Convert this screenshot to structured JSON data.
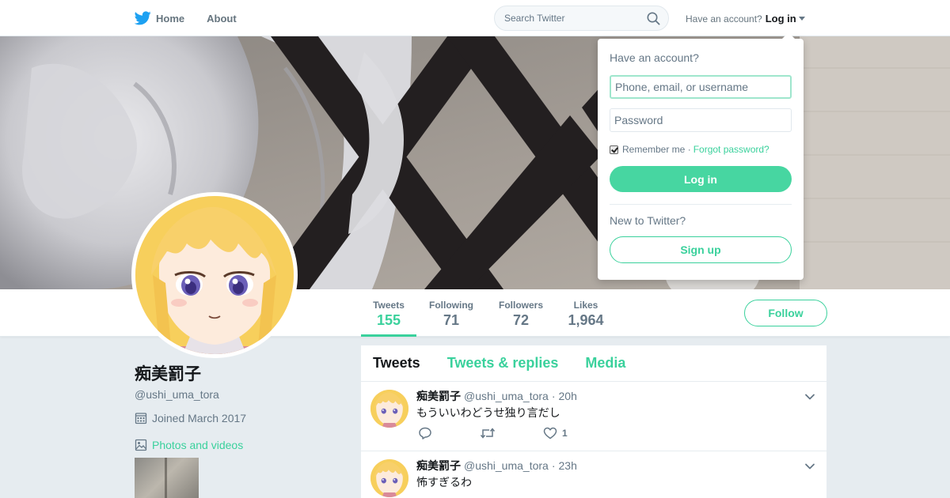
{
  "colors": {
    "accent": "#3ad19c",
    "login_button": "#47d6a1",
    "text": "#14171a",
    "secondary_text": "#657786",
    "page_background": "#e6ecf0"
  },
  "nav": {
    "logo_icon": "bird-icon",
    "home_label": "Home",
    "about_label": "About",
    "search_placeholder": "Search Twitter",
    "search_icon": "search-icon",
    "account_prompt": "Have an account?",
    "login_label": "Log in"
  },
  "profile": {
    "display_name": "痴美罰子",
    "handle": "@ushi_uma_tora",
    "joined": "Joined March 2017",
    "photos_label": "Photos and videos"
  },
  "stats": [
    {
      "label": "Tweets",
      "value": "155",
      "active": true
    },
    {
      "label": "Following",
      "value": "71",
      "active": false
    },
    {
      "label": "Followers",
      "value": "72",
      "active": false
    },
    {
      "label": "Likes",
      "value": "1,964",
      "active": false
    }
  ],
  "follow_label": "Follow",
  "timeline": {
    "tabs": [
      "Tweets",
      "Tweets & replies",
      "Media"
    ],
    "active_tab": 0,
    "tweets": [
      {
        "name": "痴美罰子",
        "handle": "@ushi_uma_tora",
        "separator": "·",
        "time": "20h",
        "text": "もういいわどうせ独り言だし",
        "likes": "1"
      },
      {
        "name": "痴美罰子",
        "handle": "@ushi_uma_tora",
        "separator": "·",
        "time": "23h",
        "text": "怖すぎるわ",
        "likes": ""
      }
    ]
  },
  "login_dropdown": {
    "title": "Have an account?",
    "username_placeholder": "Phone, email, or username",
    "password_placeholder": "Password",
    "remember_label": "Remember me ·",
    "remember_checked": true,
    "forgot_label": "Forgot password?",
    "login_button": "Log in",
    "new_prompt": "New to Twitter?",
    "signup_button": "Sign up"
  }
}
